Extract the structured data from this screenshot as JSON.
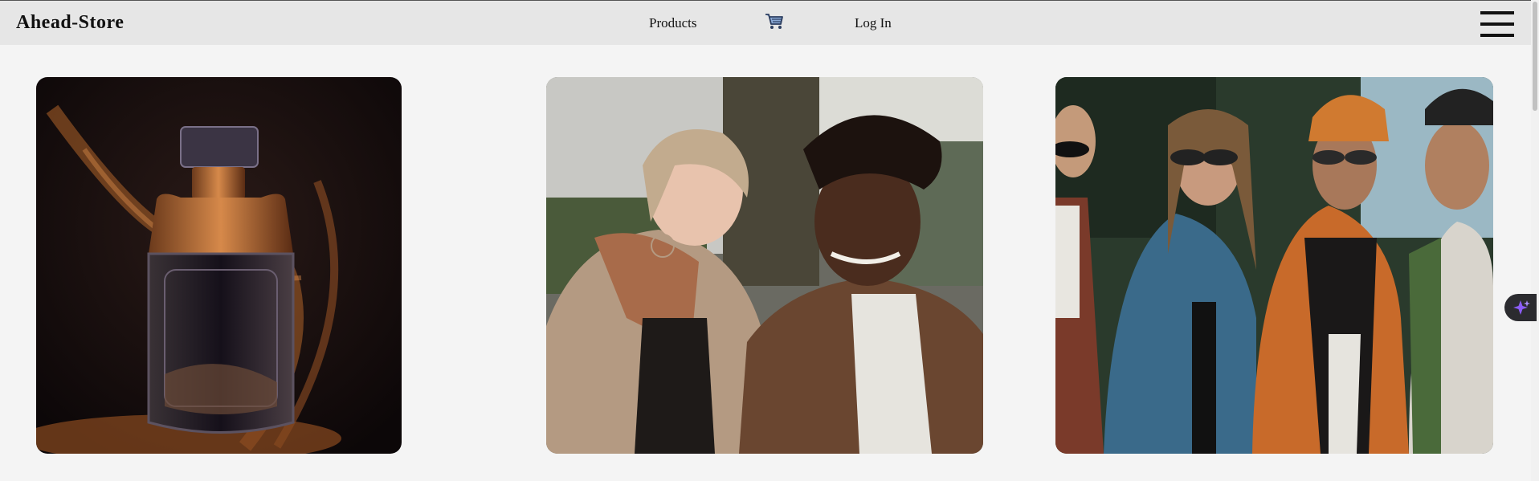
{
  "brand": "Ahead-Store",
  "nav": {
    "products": "Products",
    "cart_icon": "shopping-cart-icon",
    "login": "Log In",
    "menu_icon": "hamburger-menu-icon"
  },
  "products": [
    {
      "image": "perfume-bottle-with-golden-dust"
    },
    {
      "image": "laughing-couple-in-jackets"
    },
    {
      "image": "group-of-young-people-streetwear"
    }
  ],
  "assistant": {
    "icon": "sparkle-icon",
    "accent": "#8b5cf6"
  },
  "colors": {
    "navbar": "#e6e6e6",
    "page": "#f4f4f4"
  }
}
